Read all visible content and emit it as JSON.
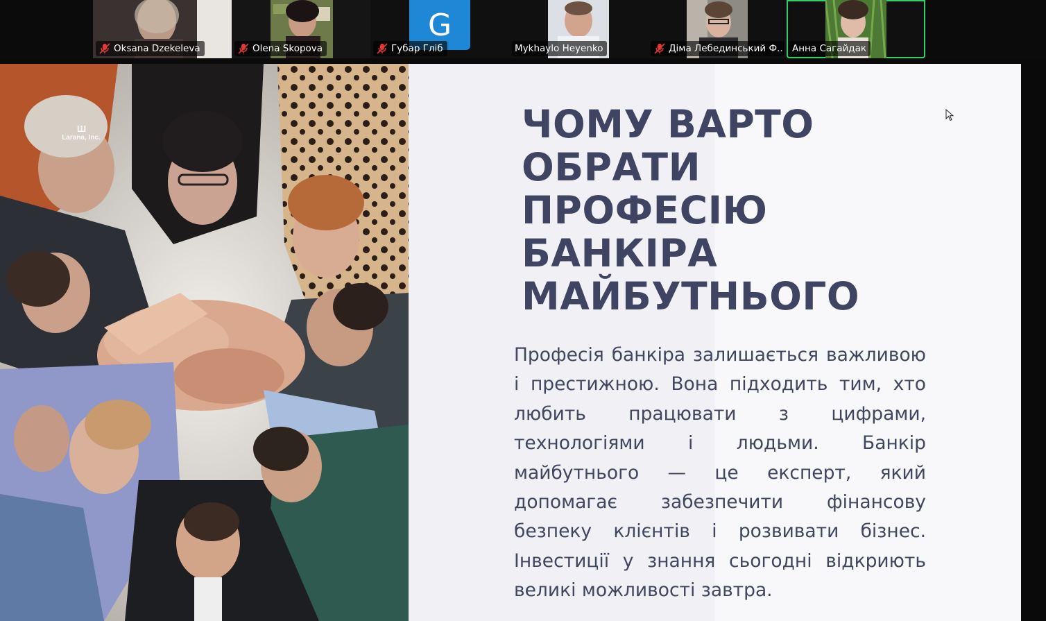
{
  "participants": [
    {
      "name": "Oksana Dzekeleva",
      "muted": true
    },
    {
      "name": "Olena Skopova",
      "muted": true
    },
    {
      "name": "Губар Гліб",
      "muted": true,
      "avatar_letter": "G"
    },
    {
      "name": "Mykhaylo Heyenko",
      "muted": false
    },
    {
      "name": "Діма Лебединський Ф...",
      "muted": true
    },
    {
      "name": "Анна Сагайдак",
      "muted": false,
      "active_speaker": true
    }
  ],
  "colors": {
    "title": "#3f4463",
    "body": "#41465f",
    "active_border": "#2fd06c",
    "avatar_bg": "#1e88d6"
  },
  "slide": {
    "photo_watermark": "Larana, Inc.",
    "title_lines": [
      "ЧОМУ ВАРТО",
      "ОБРАТИ",
      "ПРОФЕСІЮ",
      "БАНКІРА",
      "МАЙБУТНЬОГО"
    ],
    "body": "Професія банкіра залишається важливою і престижною. Вона підходить тим, хто любить працювати з цифрами, технологіями і людьми. Банкір майбутнього — це експерт, який допомагає забезпечити фінансову безпеку клієнтів і розвивати бізнес. Інвестиції у знання сьогодні відкриють великі можливості завтра."
  }
}
